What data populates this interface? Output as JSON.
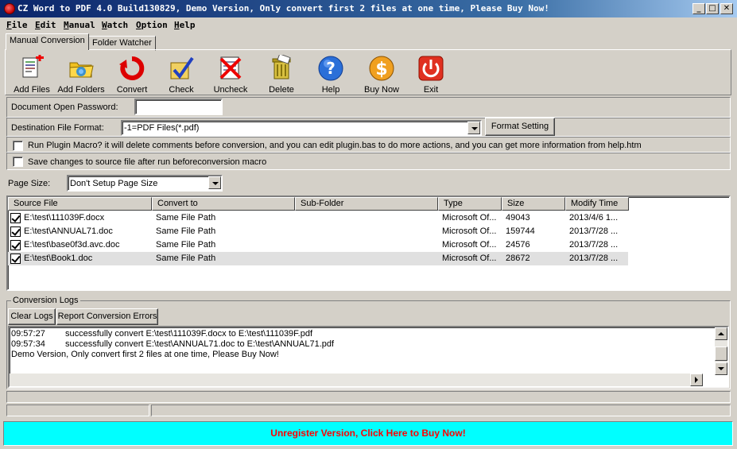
{
  "window": {
    "title": "CZ Word to PDF 4.0 Build130829, Demo Version, Only convert first 2 files at one time, Please Buy Now!",
    "min_glyph": "_",
    "max_glyph": "□",
    "close_glyph": "✕"
  },
  "menu": [
    {
      "first": "F",
      "rest": "ile"
    },
    {
      "first": "E",
      "rest": "dit"
    },
    {
      "first": "M",
      "rest": "anual"
    },
    {
      "first": "W",
      "rest": "atch"
    },
    {
      "first": "O",
      "rest": "ption"
    },
    {
      "first": "H",
      "rest": "elp"
    }
  ],
  "tabs": [
    "Manual Conversion",
    "Folder Watcher"
  ],
  "toolbar": [
    {
      "label": "Add Files",
      "icon": "add-files-icon"
    },
    {
      "label": "Add Folders",
      "icon": "add-folders-icon"
    },
    {
      "label": "Convert",
      "icon": "convert-icon"
    },
    {
      "label": "Check",
      "icon": "check-icon"
    },
    {
      "label": "Uncheck",
      "icon": "uncheck-icon"
    },
    {
      "label": "Delete",
      "icon": "delete-icon"
    },
    {
      "label": "Help",
      "icon": "help-icon"
    },
    {
      "label": "Buy Now",
      "icon": "dollar-icon"
    },
    {
      "label": "Exit",
      "icon": "power-icon"
    }
  ],
  "form": {
    "password_label": "Document Open Password:",
    "password_value": "",
    "dest_format_label": "Destination File Format:",
    "dest_format_value": "-1=PDF Files(*.pdf)",
    "format_setting_button": "Format Setting",
    "plugin_macro_label": "Run Plugin Macro? it will delete comments before conversion, and you can  edit plugin.bas to do more actions, and you can get more information from help.htm",
    "save_changes_label": "Save changes to source file after run beforeconversion macro",
    "page_size_label": "Page Size:",
    "page_size_value": "Don't Setup Page Size"
  },
  "file_list": {
    "columns": [
      "Source File",
      "Convert to",
      "Sub-Folder",
      "Type",
      "Size",
      "Modify Time"
    ],
    "rows": [
      {
        "source": "E:\\test\\111039F.docx",
        "convert_to": "Same File Path",
        "sub_folder": "",
        "type": "Microsoft Of...",
        "size": "49043",
        "modified": "2013/4/6  1...",
        "checked": true
      },
      {
        "source": "E:\\test\\ANNUAL71.doc",
        "convert_to": "Same File Path",
        "sub_folder": "",
        "type": "Microsoft Of...",
        "size": "159744",
        "modified": "2013/7/28  ...",
        "checked": true
      },
      {
        "source": "E:\\test\\base0f3d.avc.doc",
        "convert_to": "Same File Path",
        "sub_folder": "",
        "type": "Microsoft Of...",
        "size": "24576",
        "modified": "2013/7/28  ...",
        "checked": true
      },
      {
        "source": "E:\\test\\Book1.doc",
        "convert_to": "Same File Path",
        "sub_folder": "",
        "type": "Microsoft Of...",
        "size": "28672",
        "modified": "2013/7/28  ...",
        "checked": true
      }
    ]
  },
  "logs": {
    "group_title": "Conversion Logs",
    "clear_button": "Clear Logs",
    "report_button": "Report Conversion Errors",
    "lines": [
      {
        "time": "09:57:27",
        "message": "successfully convert E:\\test\\111039F.docx to E:\\test\\111039F.pdf"
      },
      {
        "time": "09:57:34",
        "message": "successfully convert E:\\test\\ANNUAL71.doc to E:\\test\\ANNUAL71.pdf"
      },
      {
        "time": "",
        "message": "Demo Version, Only convert first 2 files at one time, Please Buy Now!"
      }
    ]
  },
  "buy_banner": "Unregister Version, Click Here to Buy Now!",
  "colors": {
    "banner_bg": "#00ffff",
    "banner_text": "#ff0000",
    "titlebar": "#0a246a"
  }
}
